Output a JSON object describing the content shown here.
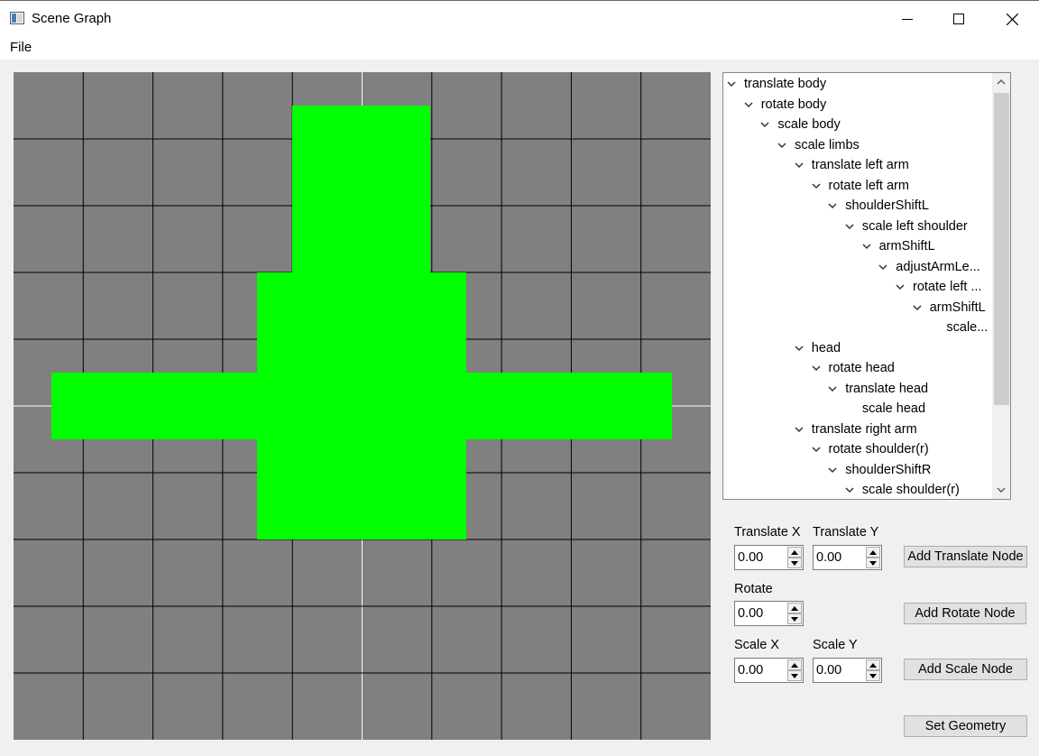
{
  "window": {
    "title": "Scene Graph",
    "icon": "app-window-icon"
  },
  "menu": {
    "file": "File"
  },
  "canvas": {
    "background": "#808080",
    "grid_color": "#000000",
    "axis_color": "#ffffff",
    "shape_color": "#00ff00"
  },
  "tree": {
    "items": [
      {
        "label": "translate body",
        "depth": 0,
        "expanded": true
      },
      {
        "label": "rotate body",
        "depth": 1,
        "expanded": true
      },
      {
        "label": "scale body",
        "depth": 2,
        "expanded": true
      },
      {
        "label": "scale limbs",
        "depth": 3,
        "expanded": true
      },
      {
        "label": "translate left arm",
        "depth": 4,
        "expanded": true
      },
      {
        "label": "rotate left arm",
        "depth": 5,
        "expanded": true
      },
      {
        "label": "shoulderShiftL",
        "depth": 6,
        "expanded": true
      },
      {
        "label": "scale left shoulder",
        "depth": 7,
        "expanded": true
      },
      {
        "label": "armShiftL",
        "depth": 8,
        "expanded": true
      },
      {
        "label": "adjustArmLe...",
        "depth": 9,
        "expanded": true
      },
      {
        "label": "rotate left ...",
        "depth": 10,
        "expanded": true
      },
      {
        "label": "armShiftL",
        "depth": 11,
        "expanded": true
      },
      {
        "label": "scale...",
        "depth": 12,
        "expanded": false
      },
      {
        "label": "head",
        "depth": 4,
        "expanded": true
      },
      {
        "label": "rotate head",
        "depth": 5,
        "expanded": true
      },
      {
        "label": "translate head",
        "depth": 6,
        "expanded": true
      },
      {
        "label": "scale head",
        "depth": 7,
        "expanded": false
      },
      {
        "label": "translate right arm",
        "depth": 4,
        "expanded": true
      },
      {
        "label": "rotate shoulder(r)",
        "depth": 5,
        "expanded": true
      },
      {
        "label": "shoulderShiftR",
        "depth": 6,
        "expanded": true
      },
      {
        "label": "scale shoulder(r)",
        "depth": 7,
        "expanded": true
      }
    ]
  },
  "controls": {
    "translate_x_label": "Translate X",
    "translate_y_label": "Translate Y",
    "translate_x_value": "0.00",
    "translate_y_value": "0.00",
    "add_translate_label": "Add Translate Node",
    "rotate_label": "Rotate",
    "rotate_value": "0.00",
    "add_rotate_label": "Add Rotate Node",
    "scale_x_label": "Scale X",
    "scale_y_label": "Scale Y",
    "scale_x_value": "0.00",
    "scale_y_value": "0.00",
    "add_scale_label": "Add Scale Node",
    "set_geometry_label": "Set Geometry"
  }
}
